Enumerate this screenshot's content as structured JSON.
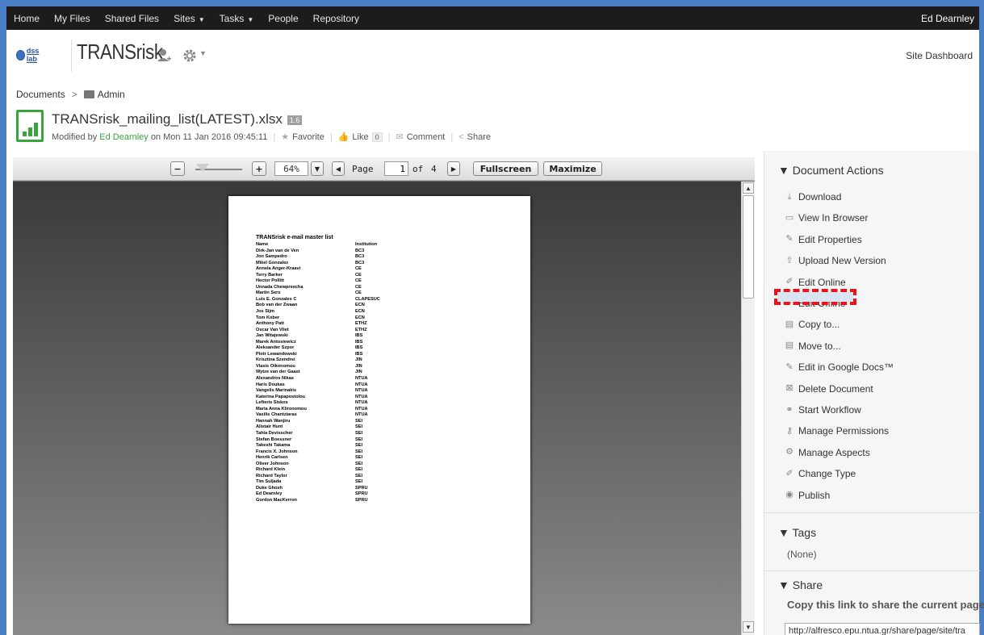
{
  "topnav": {
    "items": [
      {
        "label": "Home",
        "caret": ""
      },
      {
        "label": "My Files",
        "caret": ""
      },
      {
        "label": "Shared Files",
        "caret": ""
      },
      {
        "label": "Sites",
        "caret": "▼"
      },
      {
        "label": "Tasks",
        "caret": "▼"
      },
      {
        "label": "People",
        "caret": ""
      },
      {
        "label": "Repository",
        "caret": ""
      }
    ],
    "user": "Ed Dearnley"
  },
  "site": {
    "logo_text": "dss lab",
    "title": "TRANSrisk",
    "dashboard_link": "Site Dashboard"
  },
  "breadcrumb": {
    "root": "Documents",
    "separator": ">",
    "folder": "Admin"
  },
  "document": {
    "filename": "TRANSrisk_mailing_list(LATEST).xlsx",
    "version": "1.6",
    "modified_prefix": "Modified by",
    "modified_by": "Ed Dearnley",
    "modified_on": "on Mon 11 Jan 2016 09:45:11",
    "favorite": "Favorite",
    "like": "Like",
    "like_count": "0",
    "comment": "Comment",
    "share": "Share"
  },
  "viewer": {
    "zoom_out": "−",
    "zoom_in": "+",
    "zoom": "64%",
    "page_label": "Page",
    "page_current": "1",
    "page_of": "of",
    "page_total": "4",
    "fullscreen": "Fullscreen",
    "maximize": "Maximize"
  },
  "sheet": {
    "title": "TRANSrisk e-mail master list",
    "headers": [
      "Name",
      "Institution"
    ],
    "rows": [
      [
        "Dirk-Jan van de Ven",
        "BC3"
      ],
      [
        "Jon Sampedro",
        "BC3"
      ],
      [
        "Mikel Gonzalez",
        "BC3"
      ],
      [
        "Annela Anger-Kraavi",
        "CE"
      ],
      [
        "Terry Barker",
        "CE"
      ],
      [
        "Hector Pollitt",
        "CE"
      ],
      [
        "Unnada Chewpreecha",
        "CE"
      ],
      [
        "Martin Sers",
        "CE"
      ],
      [
        "Luis E. Gonzales C",
        "CLAPESUC"
      ],
      [
        "Bob van der Zwaan",
        "ECN"
      ],
      [
        "Jos Sijm",
        "ECN"
      ],
      [
        "Tom Kober",
        "ECN"
      ],
      [
        "Anthony Patt",
        "ETHZ"
      ],
      [
        "Oscar Van Vliet",
        "ETHZ"
      ],
      [
        "Jan Witajewski",
        "IBS"
      ],
      [
        "Marek Antosiewicz",
        "IBS"
      ],
      [
        "Aleksander Szpor",
        "IBS"
      ],
      [
        "Piotr Lewandowski",
        "IBS"
      ],
      [
        "Krisztina Szendrei",
        "JIN"
      ],
      [
        "Vlasis Oikonomou",
        "JIN"
      ],
      [
        "Wytze van der Gaast",
        "JIN"
      ],
      [
        "Alexandros Nikas",
        "NTUA"
      ],
      [
        "Haris Doukas",
        "NTUA"
      ],
      [
        "Vangelis Marinakis",
        "NTUA"
      ],
      [
        "Katerina Papapostolou",
        "NTUA"
      ],
      [
        "Lefteris Siskos",
        "NTUA"
      ],
      [
        "Maria Anna Klironomou",
        "NTUA"
      ],
      [
        "Vasilis Chantziaras",
        "NTUA"
      ],
      [
        "Hannah Wanjiru",
        "SEI"
      ],
      [
        "Alistair Hunt",
        "SEI"
      ],
      [
        "Tahia Devisscher",
        "SEI"
      ],
      [
        "Stefan Boessner",
        "SEI"
      ],
      [
        "Takeshi Takama",
        "SEI"
      ],
      [
        "Francis X. Johnson",
        "SEI"
      ],
      [
        "Henrik Carlsen",
        "SEI"
      ],
      [
        "Oliver Johnson",
        "SEI"
      ],
      [
        "Richard Klein",
        "SEI"
      ],
      [
        "Richard Taylor",
        "SEI"
      ],
      [
        "Tim Suljada",
        "SEI"
      ],
      [
        "Duke Ghosh",
        "SPRU"
      ],
      [
        "Ed Dearnley",
        "SPRU"
      ],
      [
        "Gordon MacKerron",
        "SPRU"
      ]
    ]
  },
  "actions": {
    "heading": "▼ Document Actions",
    "items": [
      {
        "label": "Download",
        "icon": "download-icon",
        "glyph": "⤓"
      },
      {
        "label": "View In Browser",
        "icon": "browser-icon",
        "glyph": "▭"
      },
      {
        "label": "Edit Properties",
        "icon": "edit-properties-icon",
        "glyph": "✎"
      },
      {
        "label": "Upload New Version",
        "icon": "upload-icon",
        "glyph": "⇧"
      },
      {
        "label": "Edit Online",
        "icon": "pencil-icon",
        "glyph": "✐"
      },
      {
        "label": "Edit Offline",
        "icon": "pencil-icon",
        "glyph": "✐"
      },
      {
        "label": "Copy to...",
        "icon": "copy-icon",
        "glyph": "▤"
      },
      {
        "label": "Move to...",
        "icon": "move-icon",
        "glyph": "▤"
      },
      {
        "label": "Edit in Google Docs™",
        "icon": "google-docs-icon",
        "glyph": "✎"
      },
      {
        "label": "Delete Document",
        "icon": "delete-icon",
        "glyph": "⊠"
      },
      {
        "label": "Start Workflow",
        "icon": "workflow-icon",
        "glyph": "⚭"
      },
      {
        "label": "Manage Permissions",
        "icon": "key-icon",
        "glyph": "⚷"
      },
      {
        "label": "Manage Aspects",
        "icon": "aspects-icon",
        "glyph": "⚙"
      },
      {
        "label": "Change Type",
        "icon": "pencil-icon",
        "glyph": "✐"
      },
      {
        "label": "Publish",
        "icon": "publish-icon",
        "glyph": "◉"
      }
    ]
  },
  "tags": {
    "heading": "▼ Tags",
    "value": "(None)"
  },
  "share_panel": {
    "heading": "▼ Share",
    "copy_label": "Copy this link to share the current page",
    "url": "http://alfresco.epu.ntua.gr/share/page/site/tra"
  },
  "colors": {
    "nav_bg": "#1c1c1c",
    "frame": "#4a7ec7",
    "accent_green": "#3aa43c",
    "highlight_red": "#e8141a"
  }
}
